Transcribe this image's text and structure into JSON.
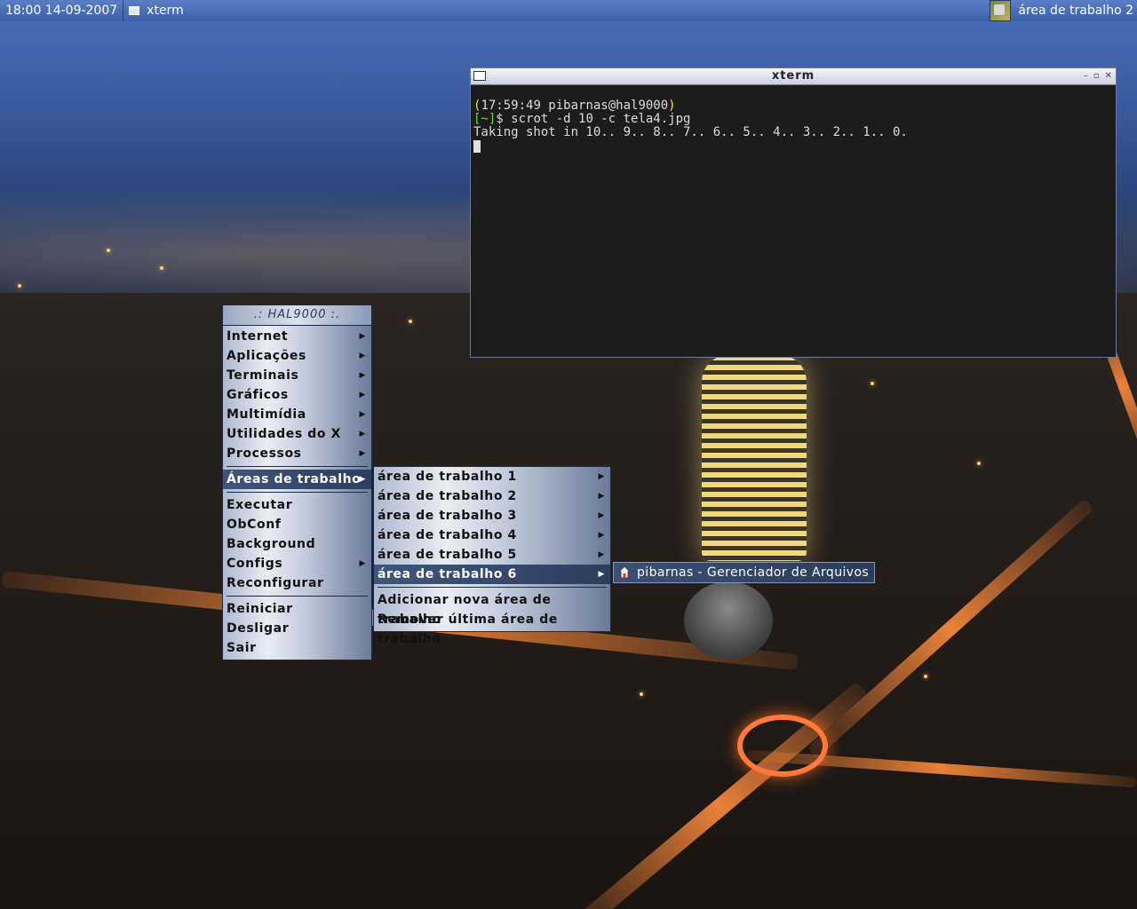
{
  "panel": {
    "clock": "18:00 14-09-2007",
    "task_label": "xterm",
    "desktop_label": "área de trabalho 2",
    "desktop_icon": "desktop-pager-icon"
  },
  "xterm": {
    "title": "xterm",
    "line1_open": "(",
    "line1_text": "17:59:49 pibarnas@hal9000",
    "line1_close": ")",
    "line2_prompt": "[~]",
    "line2_cmd": "$ scrot -d 10 -c tela4.jpg",
    "line3": "Taking shot in 10.. 9.. 8.. 7.. 6.. 5.. 4.. 3.. 2.. 1.. 0.",
    "buttons": [
      "–",
      "▫",
      "✕"
    ]
  },
  "root_menu": {
    "title": ".: HAL9000 :.",
    "items": [
      {
        "label": "Internet",
        "submenu": true
      },
      {
        "label": "Aplicações",
        "submenu": true
      },
      {
        "label": "Terminais",
        "submenu": true
      },
      {
        "label": "Gráficos",
        "submenu": true
      },
      {
        "label": "Multimídia",
        "submenu": true
      },
      {
        "label": "Utilidades do X",
        "submenu": true
      },
      {
        "label": "Processos",
        "submenu": true
      },
      {
        "label": "Áreas de trabalho",
        "submenu": true,
        "active": true
      },
      {
        "label": "Executar",
        "submenu": false
      },
      {
        "label": "ObConf",
        "submenu": false
      },
      {
        "label": "Background",
        "submenu": false
      },
      {
        "label": "Configs",
        "submenu": true
      },
      {
        "label": "Reconfigurar",
        "submenu": false
      },
      {
        "label": "Reiniciar",
        "submenu": false
      },
      {
        "label": "Desligar",
        "submenu": false
      },
      {
        "label": "Sair",
        "submenu": false
      }
    ]
  },
  "desktops_menu": {
    "items": [
      {
        "label": "área de trabalho 1"
      },
      {
        "label": "área de trabalho 2"
      },
      {
        "label": "área de trabalho 3"
      },
      {
        "label": "área de trabalho 4"
      },
      {
        "label": "área de trabalho 5"
      },
      {
        "label": "área de trabalho 6",
        "active": true
      }
    ],
    "add": "Adicionar nova área de trabalho",
    "remove": "Remover última área de trabalho"
  },
  "window_tooltip": {
    "label": "pibarnas - Gerenciador de Arquivos",
    "icon": "home-folder-icon"
  },
  "colors": {
    "panel": "#3d5fa8",
    "terminal_bg": "#1c1c1c",
    "prompt_yellow": "#f2e04a",
    "prompt_green": "#6ad14a",
    "menu_active": "#2c3d60"
  }
}
